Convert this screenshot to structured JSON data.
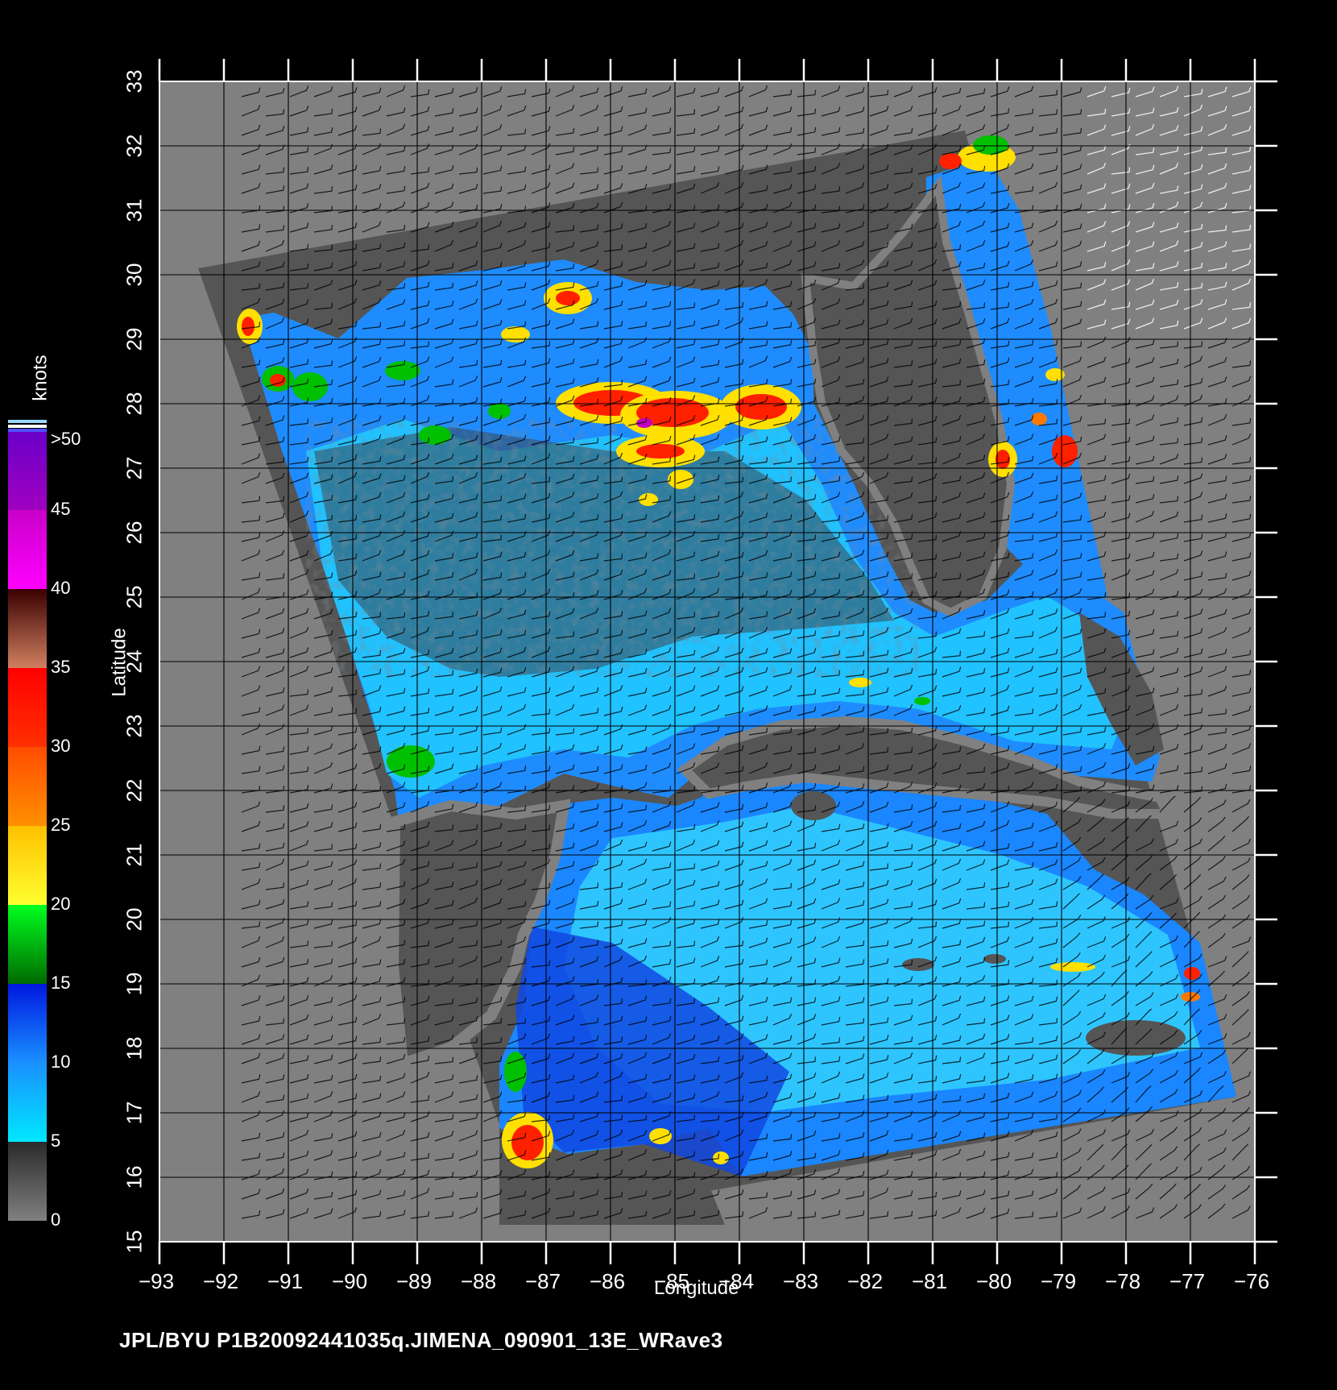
{
  "map": {
    "lon_range": [
      -93,
      -76
    ],
    "lat_range": [
      15,
      33
    ],
    "lon_ticks": [
      "-93",
      "-92",
      "-91",
      "-90",
      "-89",
      "-88",
      "-87",
      "-86",
      "-85",
      "-84",
      "-83",
      "-82",
      "-81",
      "-80",
      "-79",
      "-78",
      "-77",
      "-76"
    ],
    "lat_ticks": [
      "15",
      "16",
      "17",
      "18",
      "19",
      "20",
      "21",
      "22",
      "23",
      "24",
      "25",
      "26",
      "27",
      "28",
      "29",
      "30",
      "31",
      "32",
      "33"
    ],
    "xlabel": "Longitude",
    "ylabel": "Latitude",
    "grid": true
  },
  "colorbar": {
    "unit": "knots",
    "labels": [
      "0",
      "5",
      "10",
      "15",
      "20",
      "25",
      "30",
      "35",
      "40",
      "45",
      ">50"
    ],
    "colors": {
      "land_no_data": "#555555",
      "background": "#808080",
      "calm": "#00e8ff",
      "blue": "#0050ff",
      "green": "#00c000",
      "yellow": "#ffe000",
      "orange": "#ff7800",
      "red": "#ff1a00",
      "brown": "#a05030",
      "magenta": "#ff00ff",
      "purple": "#6a00c8"
    }
  },
  "caption": "JPL/BYU  P1B20092441035q.JIMENA_090901_13E_WRave3"
}
